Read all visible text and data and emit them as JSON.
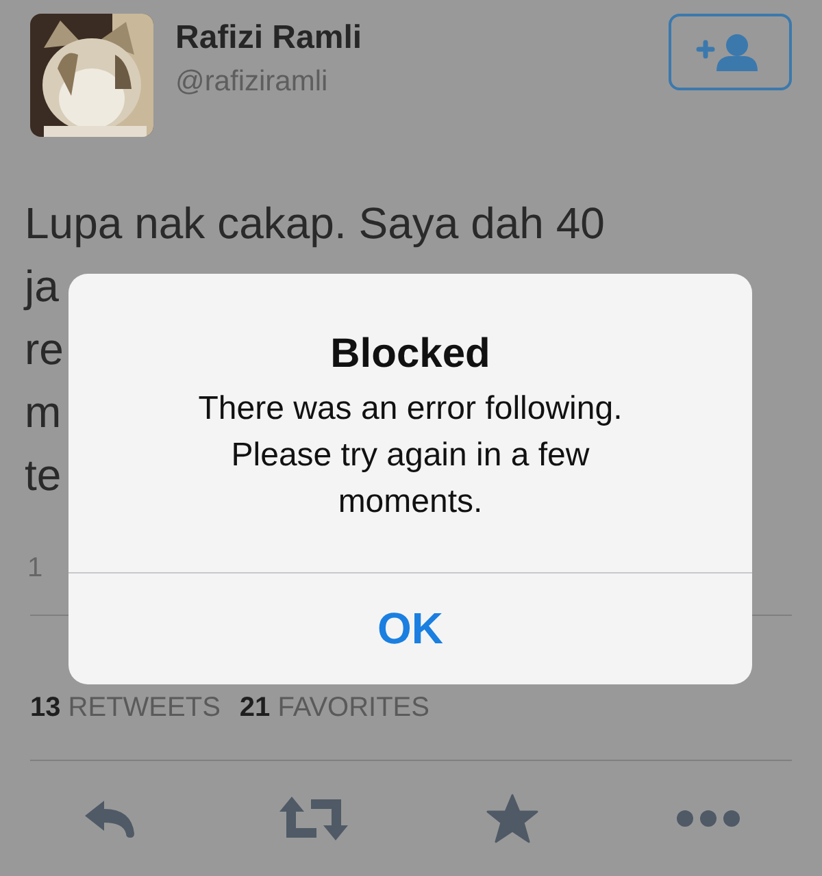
{
  "profile": {
    "name": "Rafizi Ramli",
    "handle": "@rafiziramli"
  },
  "tweet": {
    "lines": [
      "Lupa nak cakap. Saya dah 40",
      "ja",
      "re",
      "m",
      "te"
    ],
    "date": "1"
  },
  "stats": [
    {
      "count": "13",
      "label": "RETWEETS"
    },
    {
      "count": "21",
      "label": "FAVORITES"
    }
  ],
  "actions": [
    {
      "kind": "reply"
    },
    {
      "kind": "retweet"
    },
    {
      "kind": "favorite"
    },
    {
      "kind": "more"
    }
  ],
  "alert": {
    "title": "Blocked",
    "message": "There was an error following. Please try again in a few moments.",
    "button": "OK"
  }
}
